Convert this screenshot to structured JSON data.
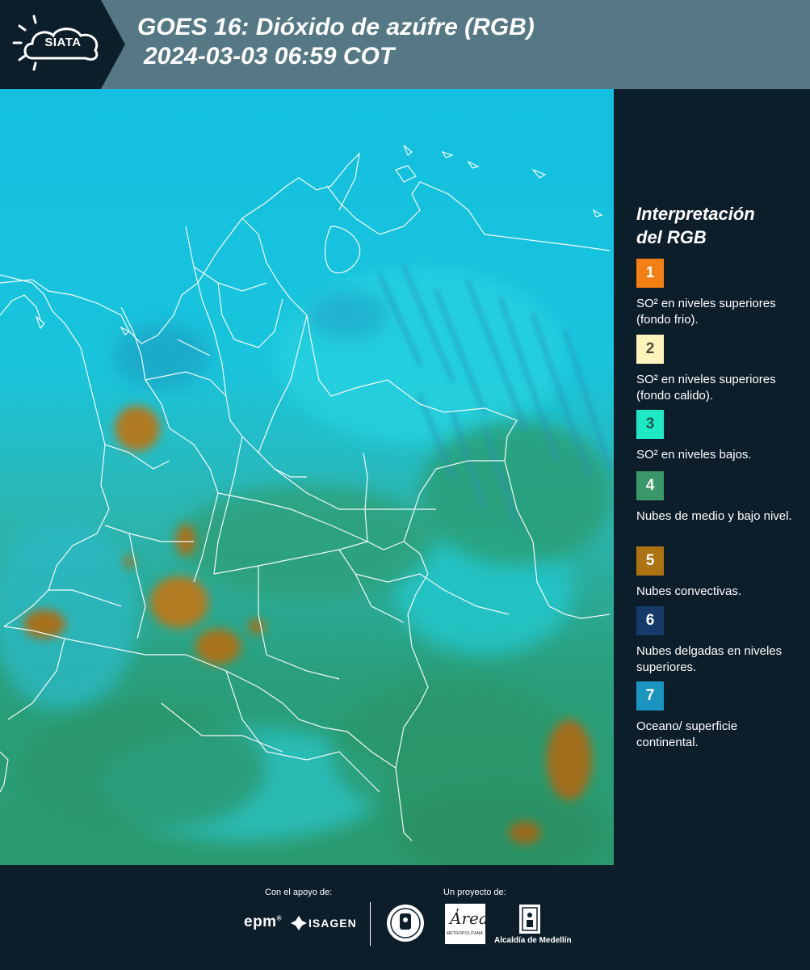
{
  "header": {
    "logo_text": "SIATA",
    "title_line1": "GOES 16: Dióxido de azúfre (RGB)",
    "title_line2": "2024-03-03 06:59 COT"
  },
  "legend": {
    "title_line1": "Interpretación",
    "title_line2": "del RGB",
    "items": [
      {
        "number": "1",
        "color": "#f47f13",
        "text_color": "#ffffff",
        "label": "SO² en niveles superiores (fondo frio)."
      },
      {
        "number": "2",
        "color": "#fdf3bd",
        "text_color": "#4a4a3a",
        "label": "SO² en niveles superiores (fondo calido)."
      },
      {
        "number": "3",
        "color": "#1fe8c4",
        "text_color": "#1e5a50",
        "label": "SO² en niveles bajos."
      },
      {
        "number": "4",
        "color": "#3a9768",
        "text_color": "#ffffff",
        "label": "Nubes de medio y bajo nivel."
      },
      {
        "number": "5",
        "color": "#ad7212",
        "text_color": "#ffffff",
        "label": "Nubes convectivas."
      },
      {
        "number": "6",
        "color": "#163b6b",
        "text_color": "#ffffff",
        "label": "Nubes delgadas en niveles superiores."
      },
      {
        "number": "7",
        "color": "#1a94c0",
        "text_color": "#ffffff",
        "label": "Oceano/ superficie continental."
      }
    ]
  },
  "footer": {
    "support_label": "Con el apoyo de:",
    "project_label": "Un proyecto de:",
    "sponsor1": "epm",
    "sponsor2": "ISAGEN",
    "partner_alcaldia": "Alcaldía de Medellín"
  }
}
